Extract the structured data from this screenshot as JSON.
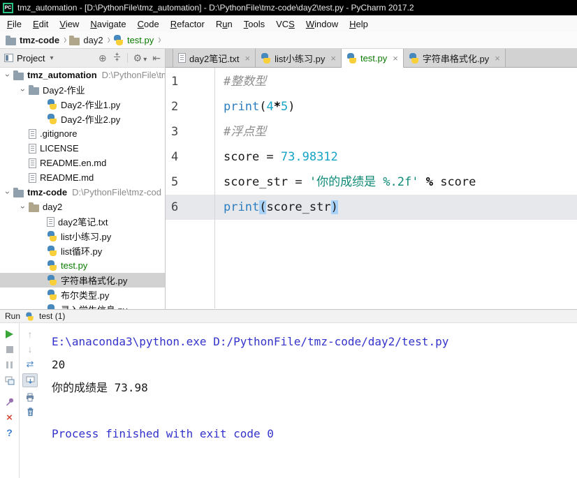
{
  "titlebar": {
    "logo": "PC",
    "title": "tmz_automation - [D:\\PythonFile\\tmz_automation] - D:\\PythonFile\\tmz-code\\day2\\test.py - PyCharm 2017.2"
  },
  "menu": {
    "items": [
      {
        "pre": "",
        "u": "F",
        "post": "ile"
      },
      {
        "pre": "",
        "u": "E",
        "post": "dit"
      },
      {
        "pre": "",
        "u": "V",
        "post": "iew"
      },
      {
        "pre": "",
        "u": "N",
        "post": "avigate"
      },
      {
        "pre": "",
        "u": "C",
        "post": "ode"
      },
      {
        "pre": "",
        "u": "R",
        "post": "efactor"
      },
      {
        "pre": "R",
        "u": "u",
        "post": "n"
      },
      {
        "pre": "",
        "u": "T",
        "post": "ools"
      },
      {
        "pre": "VC",
        "u": "S",
        "post": ""
      },
      {
        "pre": "",
        "u": "W",
        "post": "indow"
      },
      {
        "pre": "",
        "u": "H",
        "post": "elp"
      }
    ]
  },
  "breadcrumb": {
    "items": [
      {
        "label": "tmz-code"
      },
      {
        "label": "day2"
      },
      {
        "label": "test.py"
      }
    ]
  },
  "project": {
    "title": "Project",
    "tree": [
      {
        "label": "tmz_automation",
        "path": "D:\\PythonFile\\tm"
      },
      {
        "label": "Day2-作业"
      },
      {
        "label": "Day2-作业1.py"
      },
      {
        "label": "Day2-作业2.py"
      },
      {
        "label": ".gitignore"
      },
      {
        "label": "LICENSE"
      },
      {
        "label": "README.en.md"
      },
      {
        "label": "README.md"
      },
      {
        "label": "tmz-code",
        "path": "D:\\PythonFile\\tmz-cod"
      },
      {
        "label": "day2"
      },
      {
        "label": "day2笔记.txt"
      },
      {
        "label": "list小练习.py"
      },
      {
        "label": "list循环.py"
      },
      {
        "label": "test.py"
      },
      {
        "label": "字符串格式化.py"
      },
      {
        "label": "布尔类型.py"
      },
      {
        "label": "录入学生信息.py"
      }
    ]
  },
  "tabs": {
    "items": [
      {
        "label": "day2笔记.txt"
      },
      {
        "label": "list小练习.py"
      },
      {
        "label": "test.py"
      },
      {
        "label": "字符串格式化.py"
      }
    ]
  },
  "editor": {
    "lines": [
      {
        "num": "1",
        "tokens": [
          {
            "t": "#整数型"
          }
        ]
      },
      {
        "num": "2",
        "tokens": [
          {
            "t": "print"
          },
          {
            "t": "("
          },
          {
            "t": "4"
          },
          {
            "t": "*"
          },
          {
            "t": "5"
          },
          {
            "t": ")"
          }
        ]
      },
      {
        "num": "3",
        "tokens": [
          {
            "t": "#浮点型"
          }
        ]
      },
      {
        "num": "4",
        "tokens": [
          {
            "t": "score = "
          },
          {
            "t": "73.98312"
          }
        ]
      },
      {
        "num": "5",
        "tokens": [
          {
            "t": "score_str = "
          },
          {
            "t": "'你的成绩是 %.2f'"
          },
          {
            "t": " % "
          },
          {
            "t": "score"
          }
        ]
      },
      {
        "num": "6",
        "tokens": [
          {
            "t": "print"
          },
          {
            "t": "("
          },
          {
            "t": "score_str"
          },
          {
            "t": ")"
          }
        ]
      }
    ]
  },
  "run": {
    "label": "Run",
    "tab": "test (1)",
    "console": [
      {
        "text": "E:\\anaconda3\\python.exe D:/PythonFile/tmz-code/day2/test.py"
      },
      {
        "text": "20"
      },
      {
        "text": "你的成绩是 73.98"
      },
      {
        "text": " "
      },
      {
        "text": "Process finished with exit code 0"
      }
    ]
  },
  "colors": {
    "vcs_added_green": "#0a7b00",
    "builtin_blue": "#2d7ec0",
    "number_cyan": "#17a3c7",
    "string_teal": "#0e8a76",
    "console_info_blue": "#3333cc",
    "current_line": "#e6e8ec",
    "paren_match": "#a8d2f8"
  }
}
